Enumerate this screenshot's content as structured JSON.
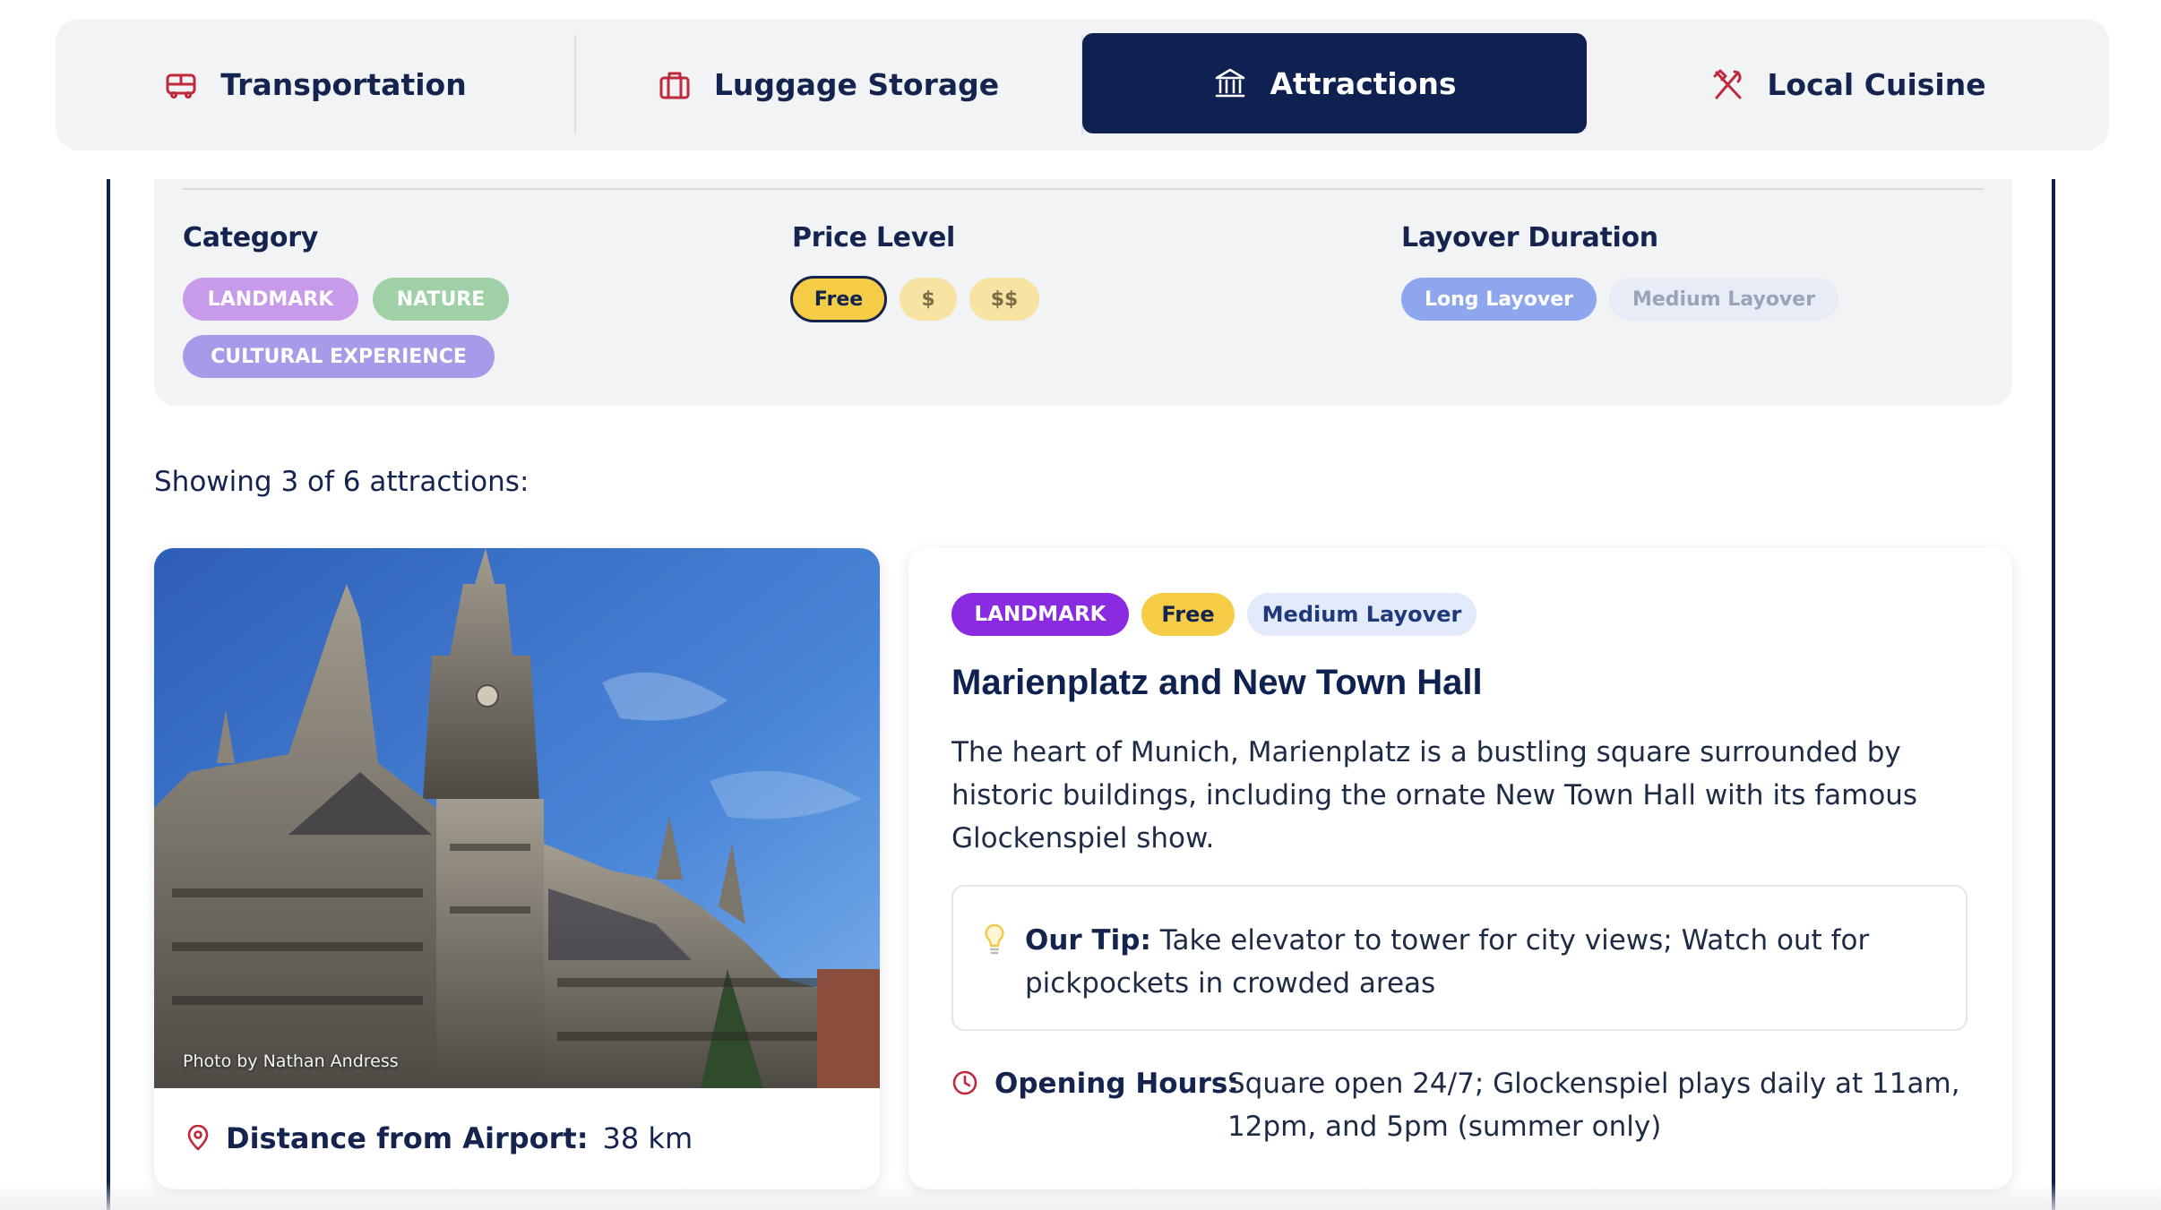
{
  "tabs": [
    {
      "label": "Transportation",
      "icon": "bus-icon",
      "active": false
    },
    {
      "label": "Luggage Storage",
      "icon": "suitcase-icon",
      "active": false
    },
    {
      "label": "Attractions",
      "icon": "museum-icon",
      "active": true
    },
    {
      "label": "Local Cuisine",
      "icon": "utensils-crossed-icon",
      "active": false
    }
  ],
  "filters": {
    "category": {
      "heading": "Category",
      "options": [
        "LANDMARK",
        "NATURE",
        "CULTURAL EXPERIENCE"
      ]
    },
    "price": {
      "heading": "Price Level",
      "options": [
        "Free",
        "$",
        "$$"
      ],
      "selected": "Free"
    },
    "duration": {
      "heading": "Layover Duration",
      "options": [
        "Long Layover",
        "Medium Layover"
      ]
    }
  },
  "results": {
    "showing_text": "Showing 3 of 6 attractions:"
  },
  "attraction": {
    "photo_credit": "Photo by Nathan Andress",
    "distance_label": "Distance from Airport:",
    "distance_value": "38 km",
    "badges": [
      "LANDMARK",
      "Free",
      "Medium Layover"
    ],
    "title": "Marienplatz and New Town Hall",
    "description": "The heart of Munich, Marienplatz is a bustling square surrounded by historic buildings, including the ornate New Town Hall with its famous Glockenspiel show.",
    "tip_label": "Our Tip:",
    "tip_text": "Take elevator to tower for city views; Watch out for pickpockets in crowded areas",
    "hours_label": "Opening Hours:",
    "hours_text": "Square open 24/7; Glockenspiel plays daily at 11am, 12pm, and 5pm (summer only)"
  },
  "colors": {
    "navy": "#0f2150",
    "accent_red": "#c0283b",
    "landmark_purple": "#8a2be2",
    "free_yellow": "#f5cc45",
    "medium_layover_bg": "#e3ebfb"
  }
}
